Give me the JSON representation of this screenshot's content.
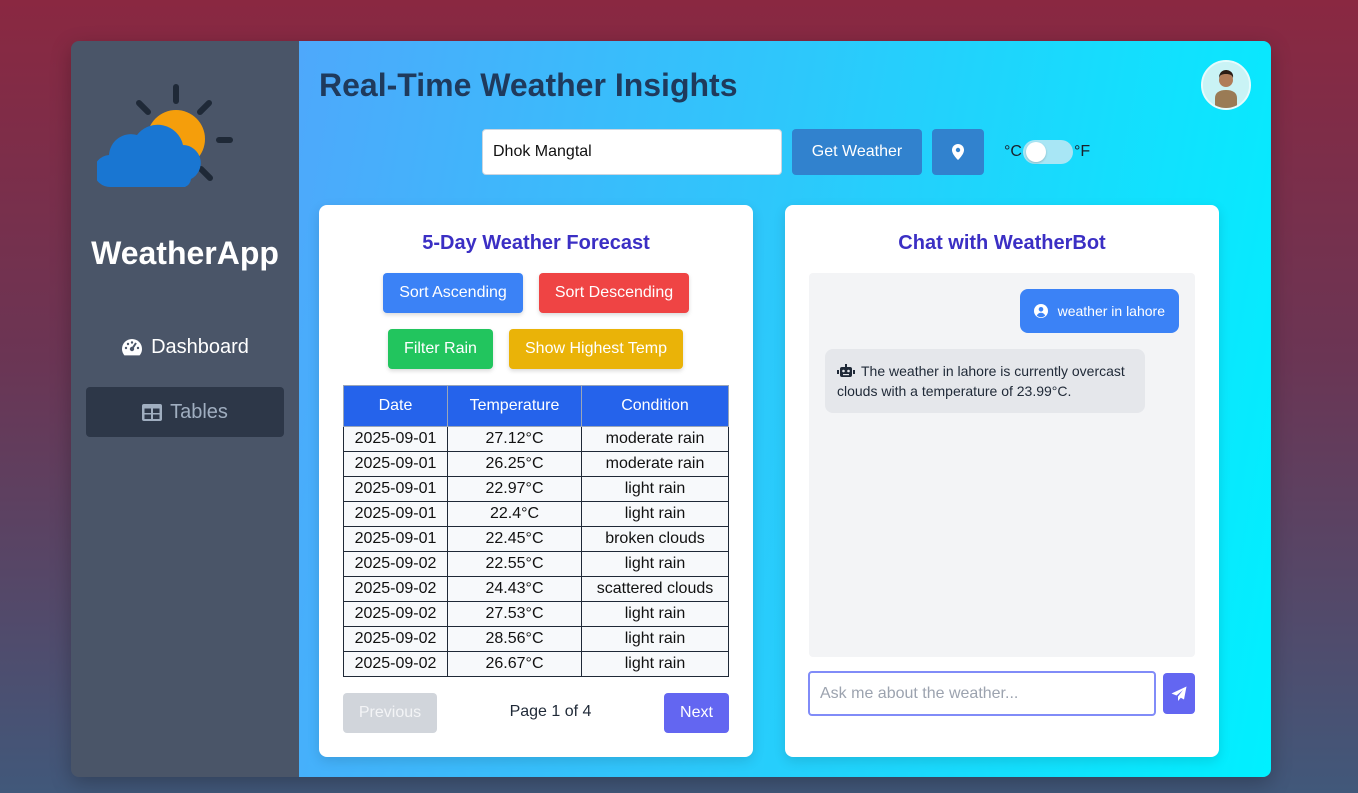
{
  "sidebar": {
    "logo_icon": "sun-cloud-icon",
    "brand": "WeatherApp",
    "items": [
      {
        "label": "Dashboard",
        "icon": "gauge-icon"
      },
      {
        "label": "Tables",
        "icon": "table-icon"
      }
    ]
  },
  "header": {
    "title": "Real-Time Weather Insights",
    "avatar_icon": "user-avatar"
  },
  "search": {
    "value": "Dhok Mangtal",
    "button_label": "Get Weather",
    "location_icon": "map-pin-icon",
    "unit_c": "°C",
    "unit_f": "°F"
  },
  "forecast": {
    "title": "5-Day Weather Forecast",
    "buttons": {
      "sort_asc": "Sort Ascending",
      "sort_desc": "Sort Descending",
      "filter_rain": "Filter Rain",
      "highest_temp": "Show Highest Temp"
    },
    "columns": [
      "Date",
      "Temperature",
      "Condition"
    ],
    "rows": [
      [
        "2025-09-01",
        "27.12°C",
        "moderate rain"
      ],
      [
        "2025-09-01",
        "26.25°C",
        "moderate rain"
      ],
      [
        "2025-09-01",
        "22.97°C",
        "light rain"
      ],
      [
        "2025-09-01",
        "22.4°C",
        "light rain"
      ],
      [
        "2025-09-01",
        "22.45°C",
        "broken clouds"
      ],
      [
        "2025-09-02",
        "22.55°C",
        "light rain"
      ],
      [
        "2025-09-02",
        "24.43°C",
        "scattered clouds"
      ],
      [
        "2025-09-02",
        "27.53°C",
        "light rain"
      ],
      [
        "2025-09-02",
        "28.56°C",
        "light rain"
      ],
      [
        "2025-09-02",
        "26.67°C",
        "light rain"
      ]
    ],
    "pager": {
      "prev": "Previous",
      "info": "Page 1 of 4",
      "next": "Next"
    }
  },
  "chat": {
    "title": "Chat with WeatherBot",
    "messages": [
      {
        "from": "user",
        "text": "weather in lahore"
      },
      {
        "from": "bot",
        "text": "The weather in lahore is currently overcast clouds with a temperature of 23.99°C."
      }
    ],
    "input_placeholder": "Ask me about the weather...",
    "send_icon": "paper-plane-icon"
  }
}
